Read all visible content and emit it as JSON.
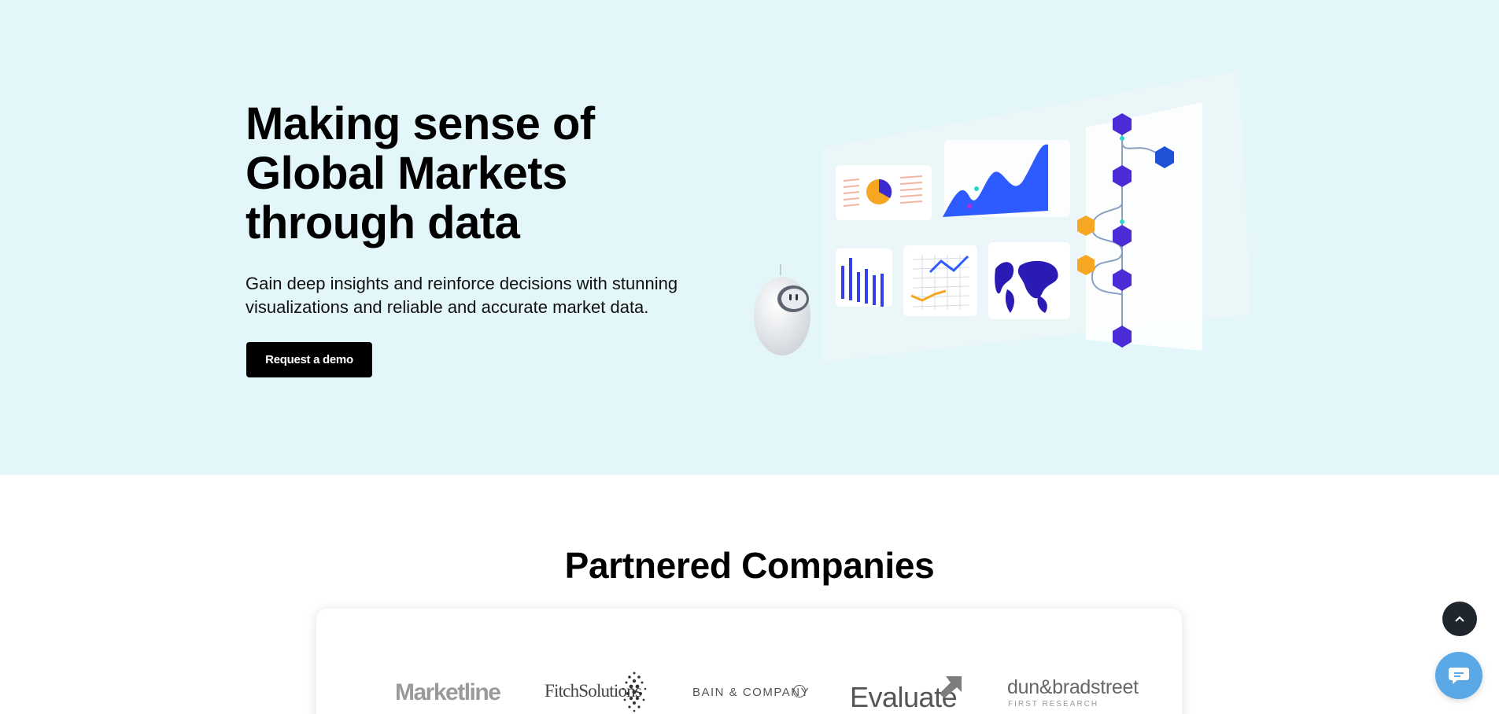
{
  "hero": {
    "title_line1": "Making sense of",
    "title_line2": "Global Markets",
    "title_line3": "through data",
    "subtitle": "Gain deep insights and reinforce decisions with stunning visualizations and reliable and accurate market data.",
    "cta_label": "Request a demo"
  },
  "partners": {
    "title": "Partnered Companies",
    "logos": {
      "marketline": "Marketline",
      "fitch": "FitchSolutions",
      "bain": "BAIN & COMPANY",
      "evaluate": "Evaluate",
      "dnb": "dun&bradstreet",
      "dnb_sub": "FIRST RESEARCH"
    }
  },
  "colors": {
    "hero_bg": "#e3f6f9",
    "cta_bg": "#000000",
    "accent_blue": "#2f5cff",
    "accent_purple": "#4b2bd6",
    "accent_orange": "#f5a623",
    "chat_bg": "#5aa8e6",
    "scroll_bg": "#20262d"
  },
  "icons": {
    "scroll_top": "chevron-up-icon",
    "chat": "chat-bubble-icon"
  }
}
